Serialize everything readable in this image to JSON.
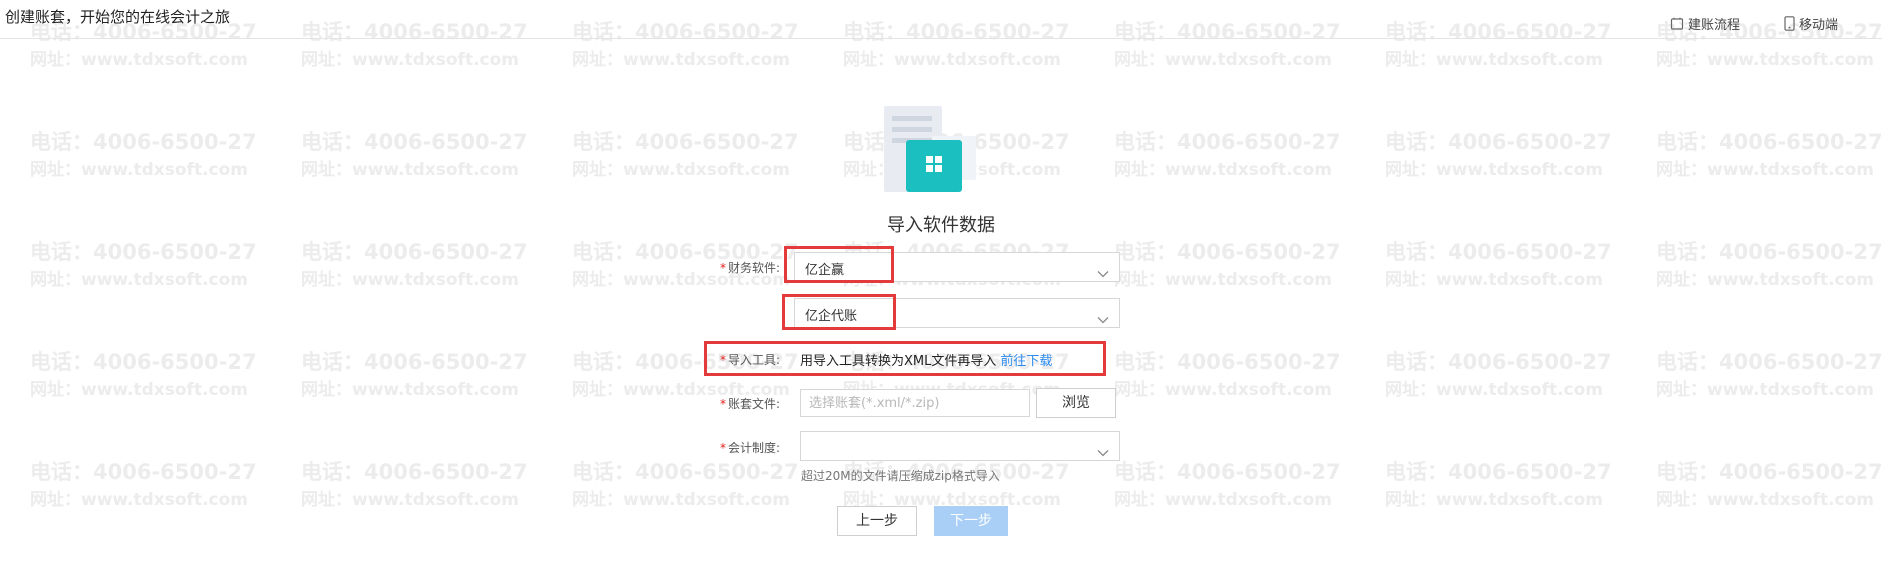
{
  "header": {
    "title": "创建账套，开始您的在线会计之旅",
    "links": [
      {
        "label": "建账流程",
        "icon": "process-icon"
      },
      {
        "label": "移动端",
        "icon": "mobile-icon"
      }
    ]
  },
  "watermark": {
    "line1": "电话：4006-6500-27",
    "line2": "网址：www.tdxsoft.com"
  },
  "main": {
    "title": "导入软件数据",
    "illustration_icon": "document-app-icon"
  },
  "form": {
    "software": {
      "label": "财务软件:",
      "value": "亿企赢"
    },
    "version": {
      "value": "亿企代账"
    },
    "tool": {
      "label": "导入工具:",
      "text": "用导入工具转换为XML文件再导入",
      "link": "前往下载"
    },
    "file": {
      "label": "账套文件:",
      "placeholder": "选择账套(*.xml/*.zip)",
      "browse": "浏览"
    },
    "system": {
      "label": "会计制度:",
      "value": ""
    },
    "hint": "超过20M的文件请压缩成zip格式导入"
  },
  "buttons": {
    "prev": "上一步",
    "next": "下一步"
  },
  "colors": {
    "accent_teal": "#1bbfbf",
    "link_blue": "#2d8cf0",
    "annotation_red": "#e33b3b",
    "next_button_disabled": "#a9cff7"
  }
}
